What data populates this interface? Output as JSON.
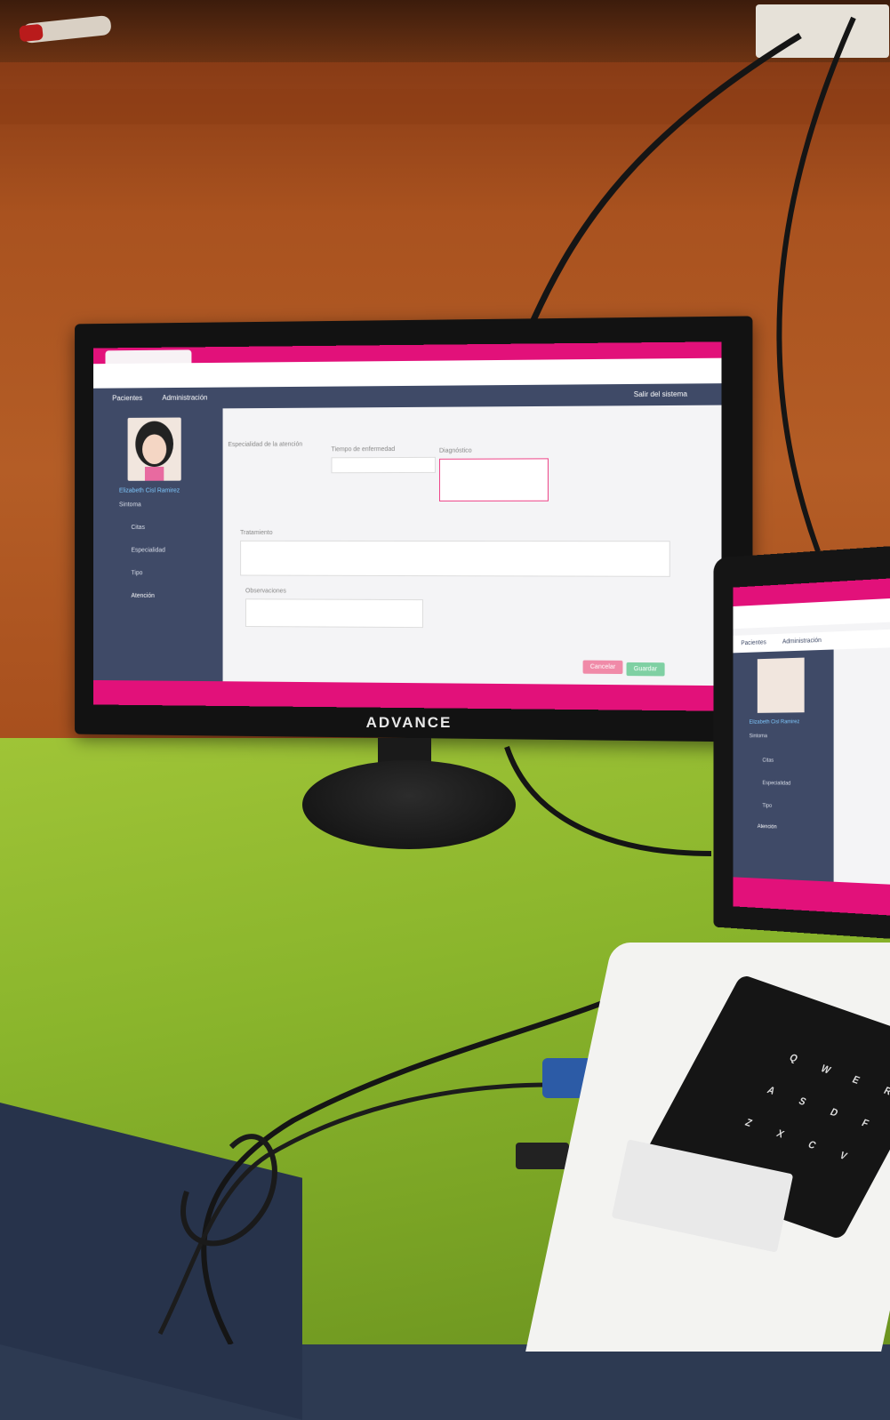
{
  "monitor": {
    "brand": "ADVANCE"
  },
  "app": {
    "nav": {
      "pacientes": "Pacientes",
      "administracion": "Administración",
      "logout": "Salir del sistema"
    },
    "user": {
      "name": "Elizabeth Cisl Ramirez"
    },
    "sidebar": [
      "Sintoma",
      "Citas",
      "Especialidad",
      "Tipo",
      "Atención"
    ],
    "form": {
      "especialidad": "Especialidad de la atención",
      "tiempo": "Tiempo de enfermedad",
      "diagnostico": "Diagnóstico",
      "tratamiento": "Tratamiento",
      "observaciones": "Observaciones"
    },
    "buttons": {
      "cancel": "Cancelar",
      "save": "Guardar"
    }
  },
  "laptop": {
    "nav": {
      "pacientes": "Pacientes",
      "administracion": "Administración"
    },
    "user": {
      "name": "Elizabeth Cisl Ramirez"
    },
    "sidebar": [
      "Sintoma",
      "Citas",
      "Especialidad",
      "Tipo",
      "Atención"
    ],
    "keys": [
      "Q",
      "W",
      "E",
      "R",
      "A",
      "S",
      "D",
      "F",
      "Z",
      "X",
      "C",
      "V"
    ]
  },
  "colors": {
    "accent": "#e2117a",
    "nav": "#3f4a67",
    "desk": "#8ab52c",
    "wall": "#a9521f"
  }
}
